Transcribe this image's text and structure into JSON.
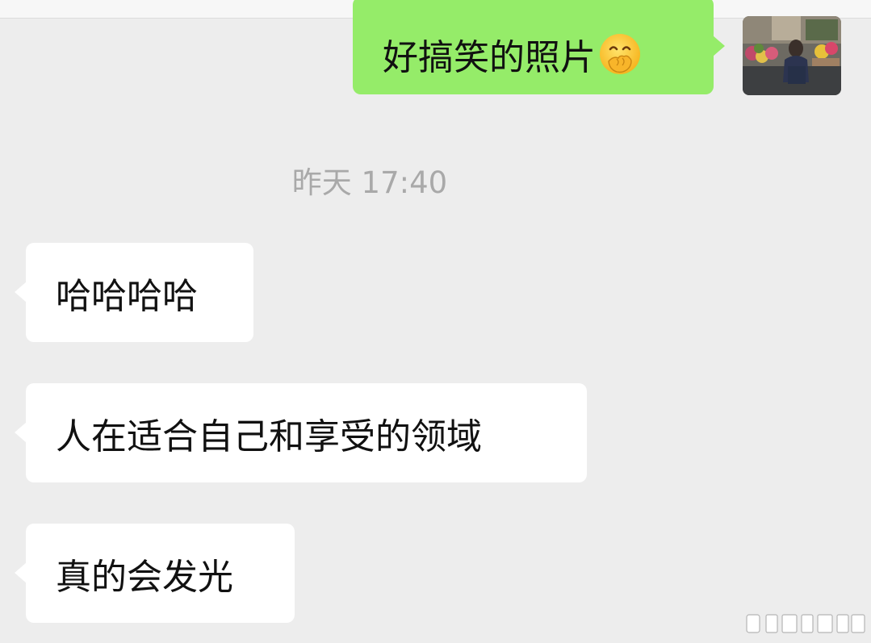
{
  "chat": {
    "outgoing": [
      {
        "text": "好搞笑的照片",
        "emoji": "hand-over-mouth-emoji"
      }
    ],
    "timestamp": "昨天 17:40",
    "incoming": [
      {
        "text": "哈哈哈哈"
      },
      {
        "text": "人在适合自己和享受的领域"
      },
      {
        "text": "真的会发光"
      }
    ]
  },
  "colors": {
    "background": "#ededed",
    "outgoing_bubble": "#95ec69",
    "incoming_bubble": "#ffffff",
    "timestamp": "#a9a9a9"
  }
}
